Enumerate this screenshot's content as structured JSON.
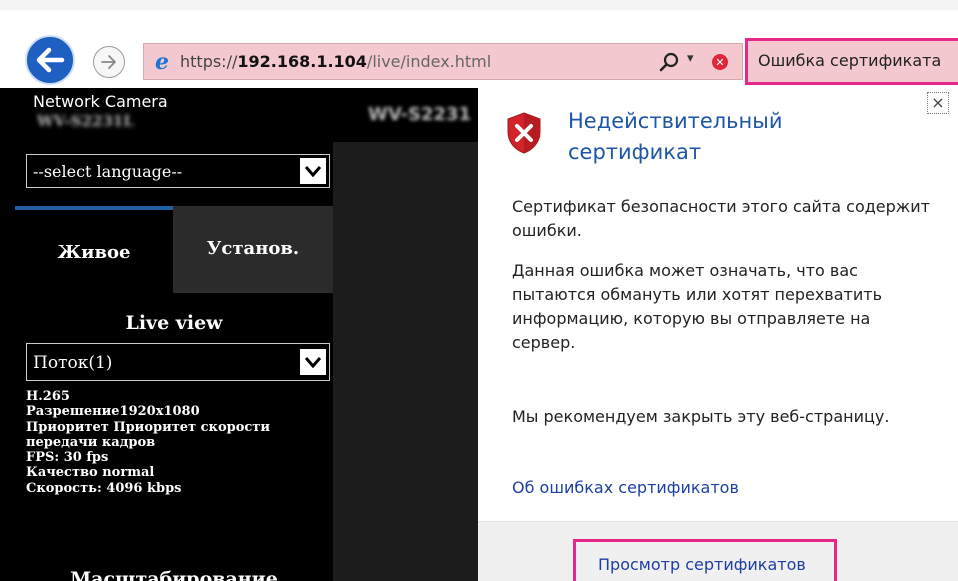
{
  "browser": {
    "url_scheme": "https://",
    "url_host": "192.168.1.104",
    "url_path": "/live/index.html",
    "cert_error_label": "Ошибка сертификата",
    "icons": {
      "back": "back-arrow-icon",
      "forward": "forward-arrow-icon",
      "ie_logo": "ie-logo-icon",
      "search": "search-icon",
      "dropdown": "chevron-down-icon",
      "cert_error": "error-x-icon"
    }
  },
  "camera": {
    "product_line": "Network Camera",
    "model_blurred": "WV-S2231L",
    "model_top_blurred": "WV-S2231",
    "language_select": "--select language--",
    "tabs": [
      {
        "label": "Живое"
      },
      {
        "label": "Установ."
      }
    ],
    "live_view_title": "Live view",
    "stream_select": "Поток(1)",
    "stream_info": [
      "H.265",
      "Разрешение1920x1080",
      "Приоритет Приоритет скорости",
      "передачи кадров",
      "FPS: 30 fps",
      "Качество normal",
      "Скорость:  4096 kbps"
    ],
    "zoom_section": "Масштабирование"
  },
  "cert_popup": {
    "title": "Недействительный сертификат",
    "paragraph1": "Сертификат безопасности этого сайта содержит ошибки.",
    "paragraph2": "Данная ошибка может означать, что вас пытаются обмануть или хотят перехватить информацию, которую вы отправляете на сервер.",
    "paragraph3": "Мы рекомендуем закрыть эту веб-страницу.",
    "about_link": "Об ошибках сертификатов",
    "view_cert_button": "Просмотр сертификатов",
    "close_symbol": "×",
    "icons": {
      "shield": "shield-error-icon",
      "close": "close-icon"
    }
  },
  "colors": {
    "address_bar_error": "#f3c9cf",
    "highlight": "#e8278a",
    "link": "#1d3fa6",
    "title_blue": "#1e56a7",
    "camera_bg": "#000000",
    "tab_accent": "#1f5fa7",
    "shield_red": "#d2232a"
  }
}
